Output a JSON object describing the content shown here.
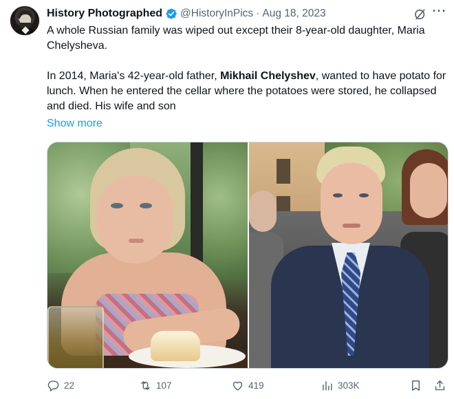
{
  "author": {
    "display_name": "History Photographed",
    "handle": "@HistoryInPics",
    "separator": "·",
    "date": "Aug 18, 2023",
    "avatar_icon": "lincoln-portrait-avatar",
    "verified_color": "#1d9bf0"
  },
  "tweet": {
    "para1": "A whole Russian family was wiped out except their 8-year-old daughter, Maria Chelysheva.",
    "para2_a": "In 2014, Maria's 42-year-old father, ",
    "para2_bold": "Mikhail Chelyshev",
    "para2_b": ", wanted to have potato for lunch. When he entered the cellar where the potatoes were stored, he collapsed and died. His wife and son",
    "show_more": "Show more"
  },
  "media": {
    "left_photo": "girl-at-table-photo",
    "right_photo": "young-man-in-suit-photo"
  },
  "actions": {
    "replies": "22",
    "retweets": "107",
    "likes": "419",
    "views": "303K"
  },
  "colors": {
    "accent": "#1d9bf0",
    "secondary_text": "#536471",
    "primary_text": "#0f1419"
  }
}
